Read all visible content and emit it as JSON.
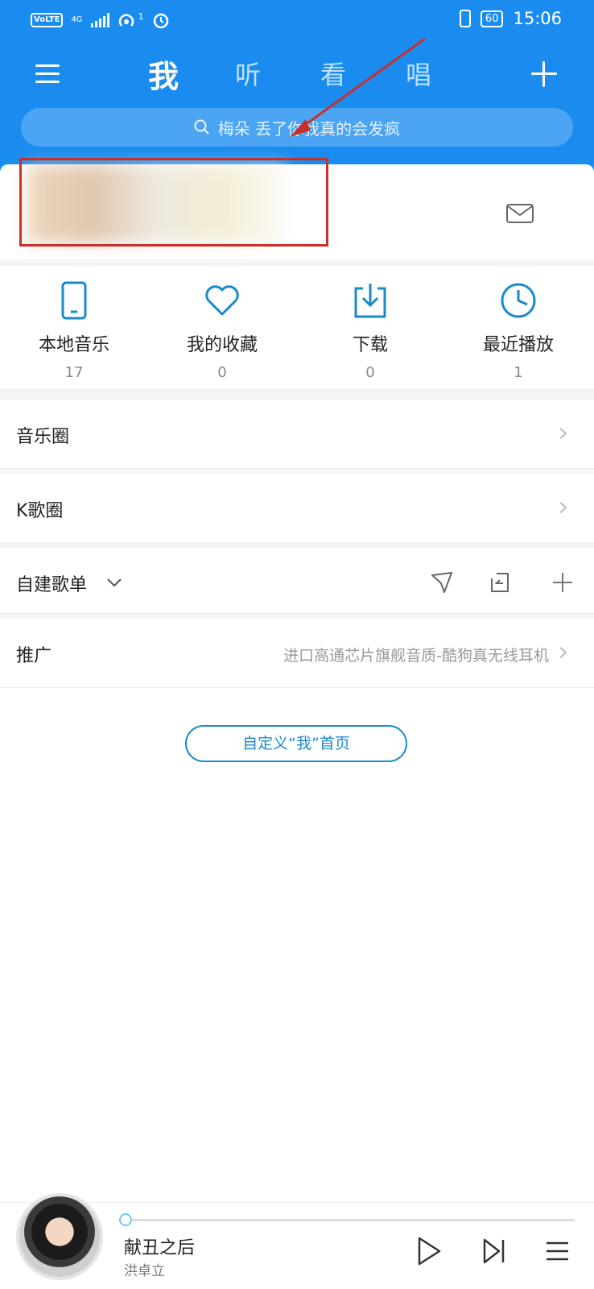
{
  "status_bar": {
    "volte": "VoLTE",
    "network": "4G",
    "hotspot_count": "1",
    "battery": "60",
    "time": "15:06"
  },
  "nav": {
    "tabs": [
      {
        "label": "我",
        "active": true
      },
      {
        "label": "听",
        "active": false
      },
      {
        "label": "看",
        "active": false
      },
      {
        "label": "唱",
        "active": false
      }
    ]
  },
  "search": {
    "placeholder": "梅朵 丢了你我真的会发疯"
  },
  "quick_entries": [
    {
      "label": "本地音乐",
      "count": "17",
      "icon": "phone-icon"
    },
    {
      "label": "我的收藏",
      "count": "0",
      "icon": "heart-icon"
    },
    {
      "label": "下载",
      "count": "0",
      "icon": "download-icon"
    },
    {
      "label": "最近播放",
      "count": "1",
      "icon": "clock-icon"
    }
  ],
  "rows": {
    "music_circle": "音乐圈",
    "k_song_circle": "K歌圈",
    "playlist": "自建歌单",
    "promo_label": "推广",
    "promo_text": "进口高通芯片旗舰音质-酷狗真无线耳机"
  },
  "custom_button": "自定义“我”首页",
  "player": {
    "song": "献丑之后",
    "artist": "洪卓立",
    "progress": 0.01
  },
  "colors": {
    "header": "#1a8cf0",
    "accent": "#1b8acb",
    "annotation": "#c9302c"
  }
}
